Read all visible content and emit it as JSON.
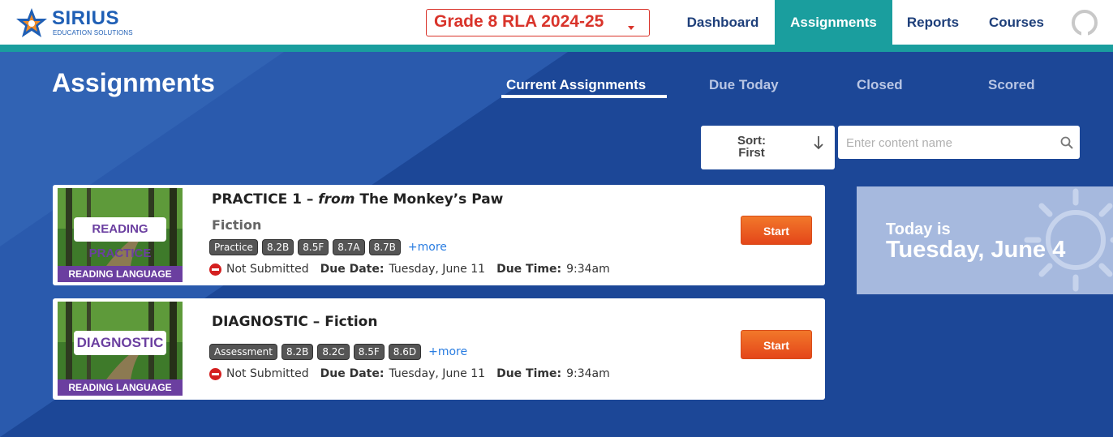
{
  "header": {
    "logo_name": "SIRIUS",
    "logo_sub": "EDUCATION SOLUTIONS",
    "course": "Grade 8 RLA 2024-25",
    "nav": {
      "dashboard": "Dashboard",
      "assignments": "Assignments",
      "reports": "Reports",
      "courses": "Courses"
    },
    "active_nav": "Assignments"
  },
  "page": {
    "title": "Assignments",
    "tabs": {
      "current": "Current Assignments",
      "due_today": "Due Today",
      "closed": "Closed",
      "scored": "Scored"
    },
    "active_tab": "Current Assignments",
    "sort": {
      "line1": "Sort:",
      "line2": "First"
    },
    "search": {
      "placeholder": "Enter content name",
      "value": ""
    }
  },
  "assignments": [
    {
      "title_prefix": "PRACTICE 1 – ",
      "title_italic": "from",
      "title_suffix": " The Monkey’s Paw",
      "genre": "Fiction",
      "thumb_label": "READING PRACTICE",
      "thumb_banner": "READING LANGUAGE ARTS",
      "tags": [
        "Practice",
        "8.2B",
        "8.5F",
        "8.7A",
        "8.7B"
      ],
      "more": "+more",
      "status": "Not Submitted",
      "due_date_label": "Due Date:",
      "due_date": "Tuesday, June 11",
      "due_time_label": "Due Time:",
      "due_time": "9:34am",
      "start": "Start"
    },
    {
      "title_prefix": "DIAGNOSTIC – Fiction",
      "title_italic": "",
      "title_suffix": "",
      "genre": "",
      "thumb_label": "DIAGNOSTIC",
      "thumb_banner": "READING LANGUAGE ARTS",
      "tags": [
        "Assessment",
        "8.2B",
        "8.2C",
        "8.5F",
        "8.6D"
      ],
      "more": "+more",
      "status": "Not Submitted",
      "due_date_label": "Due Date:",
      "due_date": "Tuesday, June 11",
      "due_time_label": "Due Time:",
      "due_time": "9:34am",
      "start": "Start"
    }
  ],
  "today": {
    "label": "Today is",
    "date": "Tuesday, June 4"
  },
  "colors": {
    "accent_teal": "#1a9e9e",
    "brand_blue": "#1f5fb5",
    "background_blue": "#1c4797",
    "alert_red": "#d9342b",
    "start_orange": "#e4461a",
    "thumb_purple": "#6b3fa0"
  },
  "icons": {
    "logo": "star-logo-icon",
    "dropdown": "caret-down-icon",
    "user": "user-avatar-icon",
    "sort": "arrow-down-icon",
    "search": "search-icon",
    "status": "no-entry-icon",
    "today": "sun-icon"
  }
}
